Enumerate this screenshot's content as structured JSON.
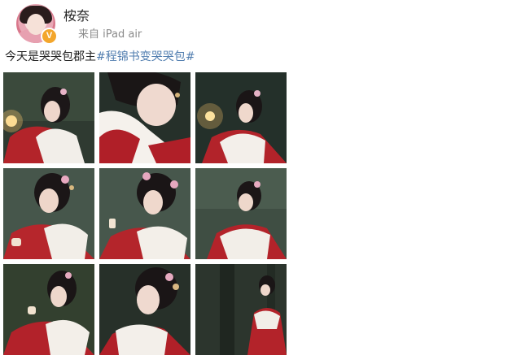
{
  "header": {
    "username": "桉奈",
    "source": "来自 iPad air",
    "verified_badge": "V",
    "avatar_icon": "user-avatar",
    "verified_color": "#f3a62c"
  },
  "post": {
    "text": "今天是哭哭包郡主",
    "hashtag": "#程锦书变哭哭包#",
    "hashtag_color": "#507daf"
  },
  "photos": [
    "photo-1",
    "photo-2",
    "photo-3",
    "photo-4",
    "photo-5",
    "photo-6",
    "photo-7",
    "photo-8",
    "photo-9"
  ]
}
